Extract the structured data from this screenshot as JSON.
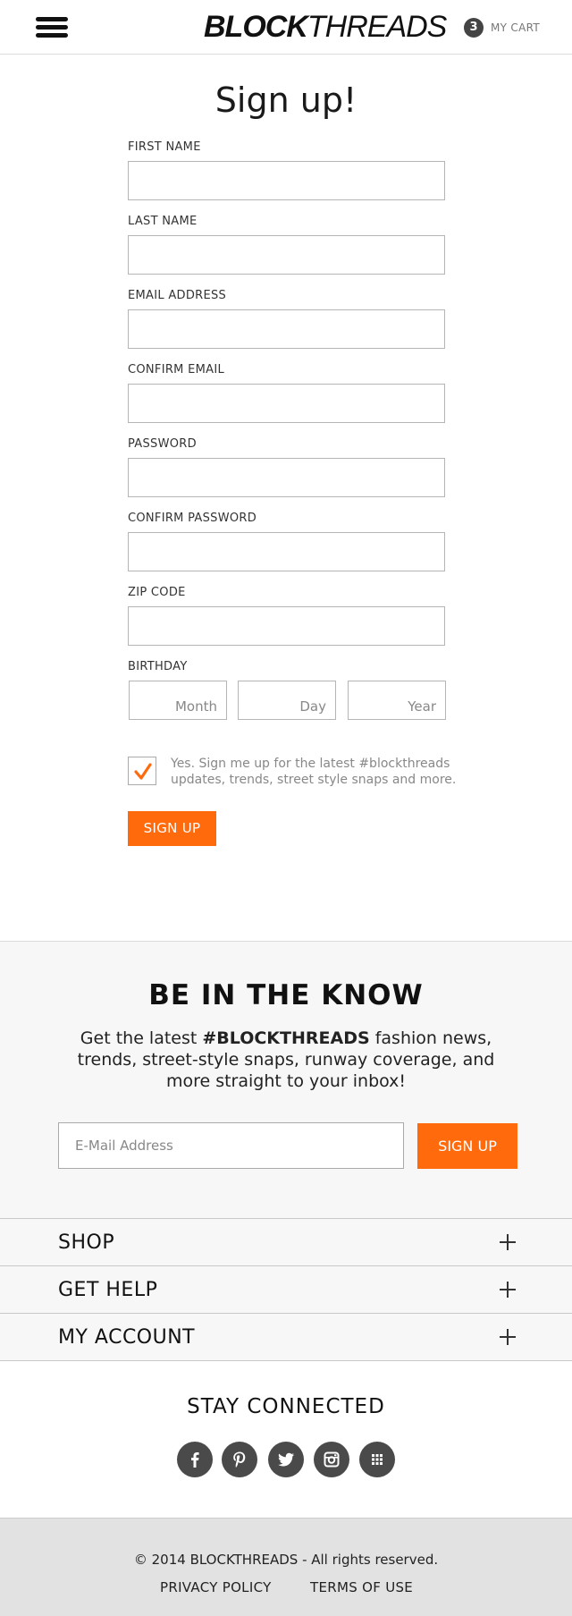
{
  "header": {
    "logo_bold": "BLOCK",
    "logo_light": "THREADS",
    "cart_count": "3",
    "cart_label": "MY CART"
  },
  "signup": {
    "title": "Sign up!",
    "fields": {
      "first_name": "FIRST NAME",
      "last_name": "LAST NAME",
      "email": "EMAIL ADDRESS",
      "confirm_email": "CONFIRM EMAIL",
      "password": "PASSWORD",
      "confirm_password": "CONFIRM PASSWORD",
      "zip": "ZIP CODE",
      "birthday": "BIRTHDAY"
    },
    "birthday": {
      "month": "Month",
      "day": "Day",
      "year": "Year"
    },
    "optin_checked": true,
    "optin_text": "Yes. Sign me up for the latest #blockthreads updates, trends, street style snaps and more.",
    "button": "SIGN UP"
  },
  "newsletter": {
    "title": "BE IN THE KNOW",
    "text_before": "Get the latest ",
    "text_bold": "#BLOCKTHREADS",
    "text_after": " fashion news, trends, street-style snaps, runway coverage, and more straight to your inbox!",
    "placeholder": "E-Mail Address",
    "button": "SIGN UP"
  },
  "accordion": [
    "SHOP",
    "GET HELP",
    "MY ACCOUNT"
  ],
  "stay_connected": {
    "title": "STAY CONNECTED",
    "icons": [
      "facebook-icon",
      "pinterest-icon",
      "twitter-icon",
      "instagram-icon",
      "apps-grid-icon"
    ]
  },
  "footer": {
    "copyright": "© 2014 BLOCKTHREADS - All rights reserved.",
    "privacy": "PRIVACY POLICY",
    "terms": "TERMS OF USE"
  },
  "colors": {
    "accent": "#ff6a0d",
    "icon_bg": "#4a4a4a",
    "footer_bg": "#e2e2e2"
  }
}
